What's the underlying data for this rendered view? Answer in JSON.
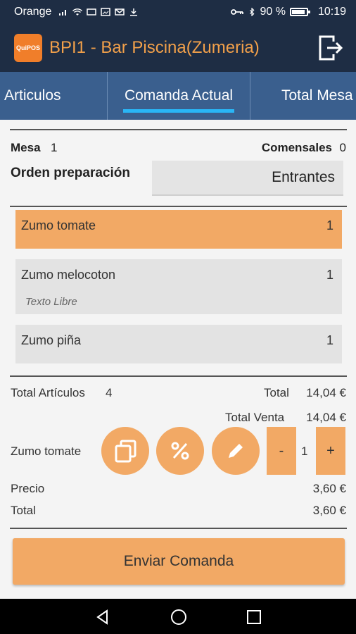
{
  "status_bar": {
    "carrier": "Orange",
    "battery_text": "90 %",
    "battery_level": 0.9,
    "time": "10:19"
  },
  "app_bar": {
    "logo_text": "QuiPOS",
    "title": "BPI1 - Bar Piscina(Zumeria)",
    "exit_icon": "exit-icon"
  },
  "tabs": [
    {
      "label": "Articulos",
      "selected": false
    },
    {
      "label": "Comanda Actual",
      "selected": true
    },
    {
      "label": "Total Mesa",
      "selected": false
    }
  ],
  "colors": {
    "header": "#1e2d44",
    "tab_bar": "#3a5f8e",
    "tab_indicator": "#29b6f6",
    "accent": "#f2a965",
    "selected_item": "#f2a965",
    "title": "#f2a04a"
  },
  "order": {
    "mesa_label": "Mesa",
    "mesa_value": "1",
    "comensales_label": "Comensales",
    "comensales_value": "0",
    "prep_order_label": "Orden preparación",
    "prep_order_value": "Entrantes"
  },
  "items": [
    {
      "name": "Zumo tomate",
      "qty": "1",
      "note": "",
      "selected": true
    },
    {
      "name": "Zumo melocoton",
      "qty": "1",
      "note": "Texto Libre",
      "selected": false
    },
    {
      "name": "Zumo piña",
      "qty": "1",
      "note": "",
      "selected": false
    }
  ],
  "summary": {
    "total_articulos_label": "Total Artículos",
    "total_articulos_value": "4",
    "total_label": "Total",
    "total_value": "14,04 €",
    "total_venta_label": "Total Venta",
    "total_venta_value": "14,04 €"
  },
  "selected_item": {
    "name": "Zumo tomate",
    "copy_icon": "copy-icon",
    "percent_icon": "percent-icon",
    "edit_icon": "pencil-icon",
    "minus_label": "-",
    "qty": "1",
    "plus_label": "+",
    "precio_label": "Precio",
    "precio_value": "3,60 €",
    "total_label": "Total",
    "total_value": "3,60 €"
  },
  "send_button": "Enviar Comanda",
  "nav": [
    "back-icon",
    "home-icon",
    "recents-icon"
  ]
}
